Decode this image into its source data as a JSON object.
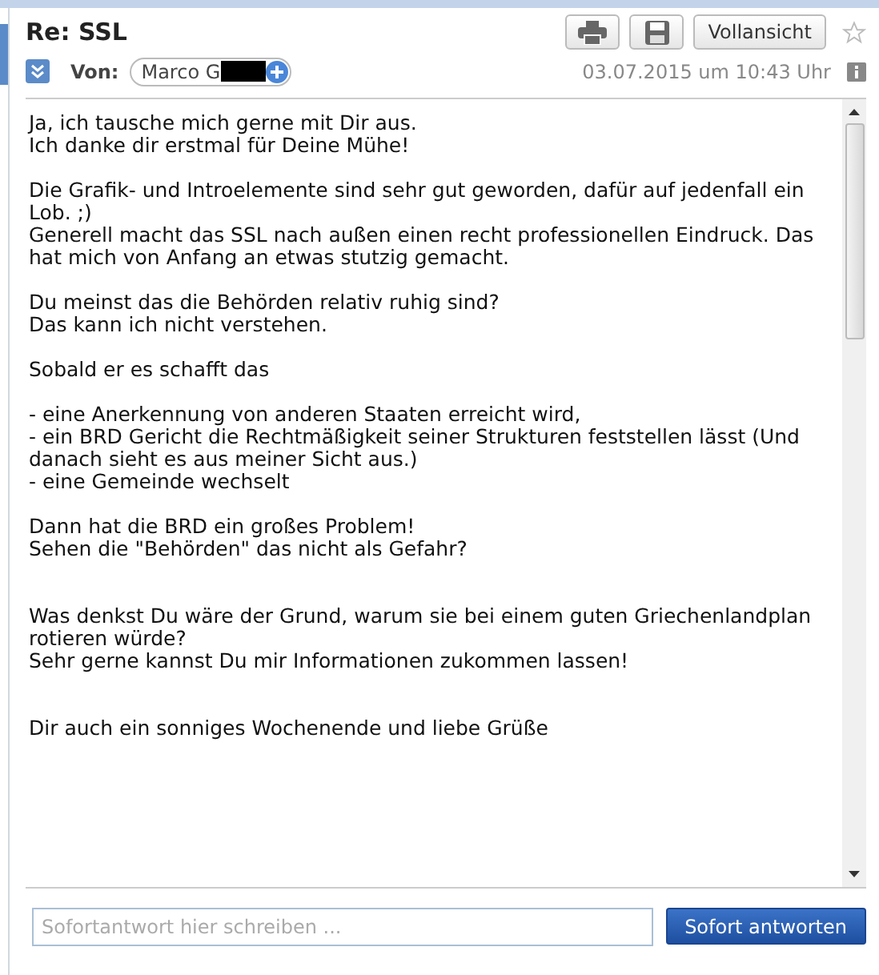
{
  "subject": "Re: SSL",
  "toolbar": {
    "fullview_label": "Vollansicht",
    "starred": false
  },
  "from": {
    "label": "Von:",
    "name": "Marco G"
  },
  "date": "03.07.2015 um 10:43 Uhr",
  "body": "Ja, ich tausche mich gerne mit Dir aus.\nIch danke dir erstmal für Deine Mühe!\n\nDie Grafik- und Introelemente sind sehr gut geworden, dafür auf jedenfall ein Lob. ;)\nGenerell macht das SSL nach außen einen recht professionellen Eindruck. Das hat mich von Anfang an etwas stutzig gemacht.\n\nDu meinst das die Behörden relativ ruhig sind?\nDas kann ich nicht verstehen.\n\nSobald er es schafft das\n\n- eine Anerkennung von anderen Staaten erreicht wird,\n- ein BRD Gericht die Rechtmäßigkeit seiner Strukturen feststellen lässt (Und danach sieht es aus meiner Sicht aus.)\n- eine Gemeinde wechselt\n\nDann hat die BRD ein großes Problem!\nSehen die \"Behörden\" das nicht als Gefahr?\n\n\nWas denkst Du wäre der Grund, warum sie bei einem guten Griechenlandplan rotieren würde?\nSehr gerne kannst Du mir Informationen zukommen lassen!\n\n\nDir auch ein sonniges Wochenende und liebe Grüße",
  "reply": {
    "placeholder": "Sofortantwort hier schreiben ...",
    "button": "Sofort antworten"
  }
}
